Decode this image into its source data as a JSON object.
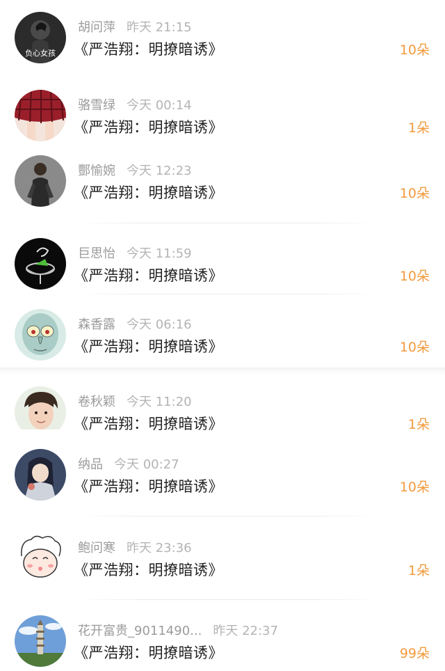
{
  "gifts": [
    {
      "name": "胡问萍",
      "time": "昨天 21:15",
      "title": "《严浩翔：明撩暗诱》",
      "count": "10朵",
      "avatar": "avatar-dark-text-icon"
    },
    {
      "name": "骆雪绿",
      "time": "今天 00:14",
      "title": "《严浩翔：明撩暗诱》",
      "count": "1朵",
      "avatar": "avatar-plaid-skirt-icon"
    },
    {
      "name": "酆愉婉",
      "time": "今天 12:23",
      "title": "《严浩翔：明撩暗诱》",
      "count": "10朵",
      "avatar": "avatar-person-icon"
    },
    {
      "name": "巨思怡",
      "time": "今天 11:59",
      "title": "《严浩翔：明撩暗诱》",
      "count": "10朵",
      "avatar": "avatar-glass-icon"
    },
    {
      "name": "森香露",
      "time": "今天 06:16",
      "title": "《严浩翔：明撩暗诱》",
      "count": "10朵",
      "avatar": "avatar-cartoon-squid-icon"
    },
    {
      "name": "卷秋颖",
      "time": "今天 11:20",
      "title": "《严浩翔：明撩暗诱》",
      "count": "1朵",
      "avatar": "avatar-face-icon"
    },
    {
      "name": "纳品",
      "time": "今天 00:27",
      "title": "《严浩翔：明撩暗诱》",
      "count": "10朵",
      "avatar": "avatar-anime-icon"
    },
    {
      "name": "鲍问寒",
      "time": "昨天 23:36",
      "title": "《严浩翔：明撩暗诱》",
      "count": "1朵",
      "avatar": "avatar-sheep-icon"
    },
    {
      "name": "花开富贵_9011490...",
      "time": "昨天 22:37",
      "title": "《严浩翔：明撩暗诱》",
      "count": "99朵",
      "avatar": "avatar-pagoda-icon"
    }
  ],
  "avatar_label": "负心女孩",
  "colors": {
    "accent": "#f39a3c",
    "name": "#9b9b9b",
    "title": "#222222"
  }
}
